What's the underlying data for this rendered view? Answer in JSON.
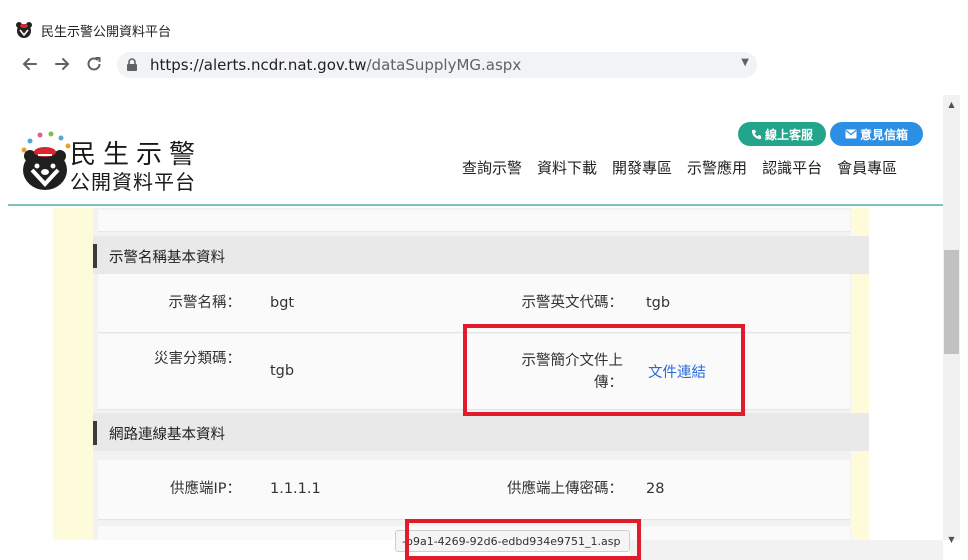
{
  "browser": {
    "tab_title": "民生示警公開資料平台",
    "url_host": "https://alerts.ncdr.nat.gov.tw",
    "url_path": "/dataSupplyMG.aspx",
    "status_url": "-b9a1-4269-92d6-edbd934e9751_1.asp"
  },
  "header": {
    "brand_line1": "民生示警",
    "brand_line2": "公開資料平台",
    "service_button": "線上客服",
    "feedback_button": "意見信箱",
    "nav": [
      "查詢示警",
      "資料下載",
      "開發專區",
      "示警應用",
      "認識平台",
      "會員專區"
    ]
  },
  "section1": {
    "title": "示警名稱基本資料",
    "fields": {
      "alert_name_label": "示警名稱：",
      "alert_name_value": "bgt",
      "alert_code_label": "示警英文代碼：",
      "alert_code_value": "tgb",
      "disaster_label": "災害分類碼：",
      "disaster_value": "tgb",
      "doc_label_line1": "示警簡介文件上",
      "doc_label_line2": "傳：",
      "doc_link": "文件連結"
    }
  },
  "section2": {
    "title": "網路連線基本資料",
    "fields": {
      "ip_label": "供應端IP：",
      "ip_value": "1.1.1.1",
      "pwd_label": "供應端上傳密碼：",
      "pwd_value": "28"
    }
  },
  "colors": {
    "highlight": "#e21b2c",
    "service_pill": "#23a58b",
    "feedback_pill": "#2b8fe6",
    "link": "#2b69d8"
  }
}
